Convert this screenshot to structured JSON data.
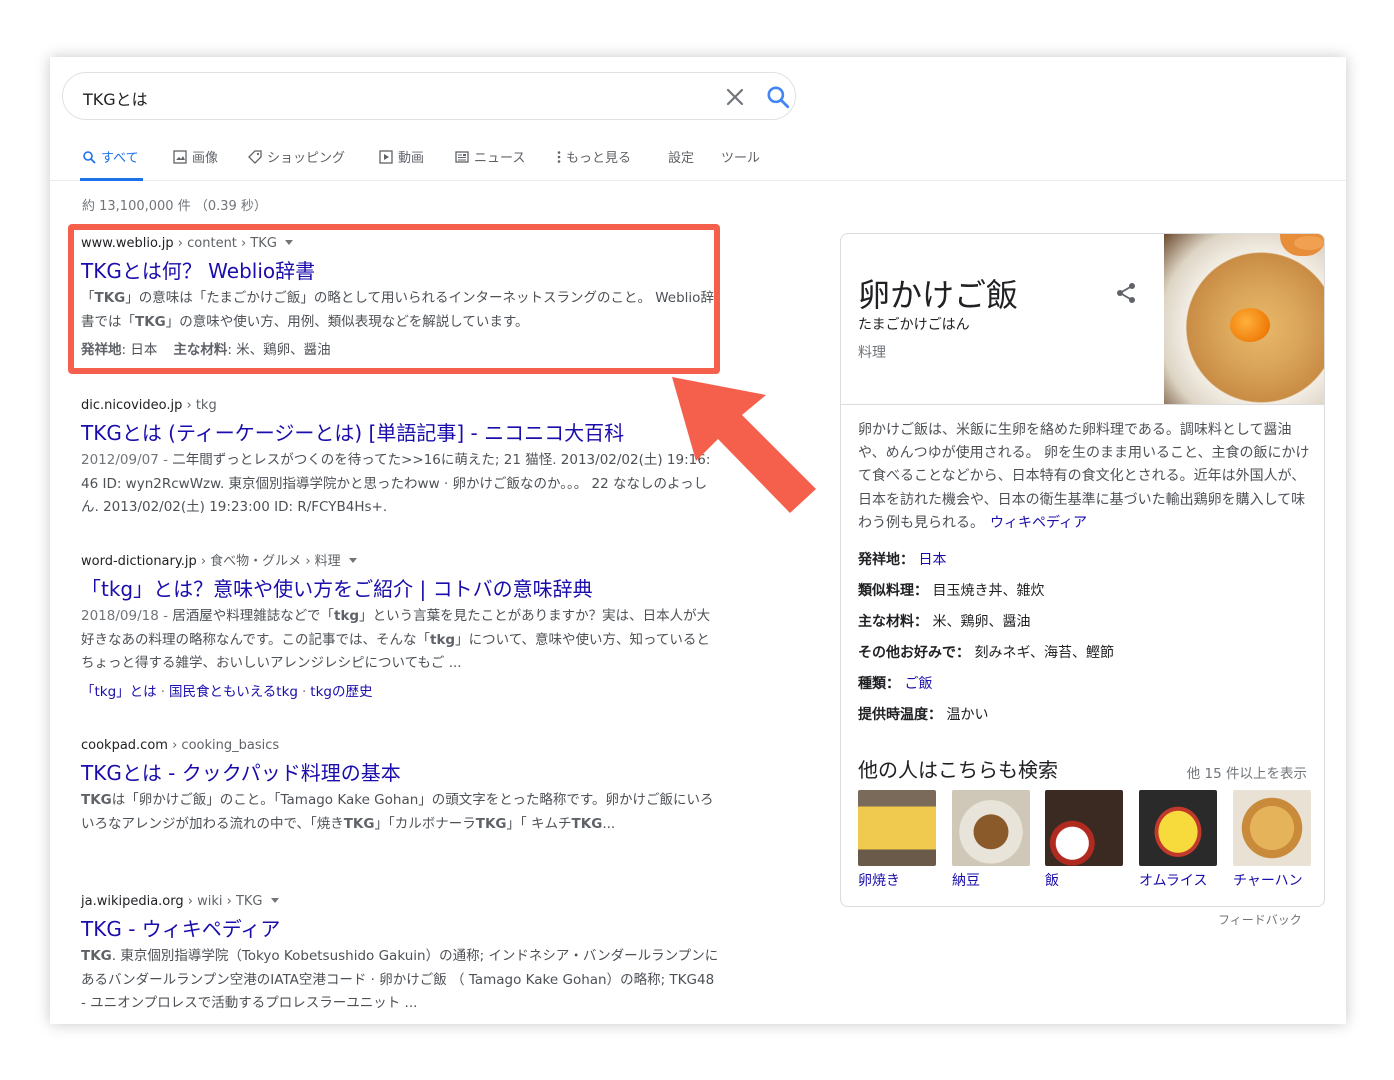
{
  "search": {
    "query": "TKGとは"
  },
  "tabs": [
    {
      "label": "すべて",
      "icon": "search-icon",
      "active": true
    },
    {
      "label": "画像",
      "icon": "image-icon"
    },
    {
      "label": "ショッピング",
      "icon": "tag-icon"
    },
    {
      "label": "動画",
      "icon": "play-icon"
    },
    {
      "label": "ニュース",
      "icon": "news-icon"
    },
    {
      "label": "もっと見る",
      "icon": "more-vert-icon"
    },
    {
      "label": "設定"
    },
    {
      "label": "ツール"
    }
  ],
  "stats": "約 13,100,000 件 （0.39 秒）",
  "results": [
    {
      "domain": "www.weblio.jp",
      "path": " › content › TKG",
      "title": "TKGとは何？ Weblio辞書",
      "snippet_parts": [
        "「",
        "TKG",
        "」の意味は「たまごかけご飯」の略として用いられるインターネットスラングのこと。 Weblio辞書では「",
        "TKG",
        "」の意味や使い方、用例、類似表現などを解説しています。"
      ],
      "meta": [
        {
          "key": "発祥地",
          "value": ": 日本"
        },
        {
          "key": "主な材料",
          "value": ": 米、鶏卵、醤油"
        }
      ]
    },
    {
      "domain": "dic.nicovideo.jp",
      "path": " › tkg",
      "title": "TKGとは (ティーケージーとは) [単語記事] - ニコニコ大百科",
      "date": "2012/09/07 - ",
      "snippet": "二年間ずっとレスがつくのを待ってた>>16に萌えた; 21 猫怪. 2013/02/02(土) 19:16: 46 ID: wyn2RcwWzw. 東京個別指導学院かと思ったわww · 卵かけご飯なのか。。。 22 ななしのよっしん. 2013/02/02(土) 19:23:00 ID: R/FCYB4Hs+."
    },
    {
      "domain": "word-dictionary.jp",
      "path": " › 食べ物・グルメ › 料理",
      "title": "「tkg」とは？意味や使い方をご紹介 | コトバの意味辞典",
      "date": "2018/09/18 - ",
      "snippet_parts": [
        "居酒屋や料理雑誌などで「",
        "tkg",
        "」という言葉を見たことがありますか？実は、日本人が大好きなあの料理の略称なんです。この記事では、そんな「",
        "tkg",
        "」について、意味や使い方、知っているとちょっと得する雑学、おいしいアレンジレシピについてもご ..."
      ],
      "sublinks": [
        "「tkg」とは",
        "国民食ともいえるtkg",
        "tkgの歴史"
      ]
    },
    {
      "domain": "cookpad.com",
      "path": " › cooking_basics",
      "title": "TKGとは - クックパッド料理の基本",
      "snippet_parts": [
        "TKG",
        "は「卵かけご飯」のこと。「Tamago Kake Gohan」の頭文字をとった略称です。卵かけご飯にいろいろなアレンジが加わる流れの中で、「焼き",
        "TKG",
        "」「カルボナーラ",
        "TKG",
        "」「 キムチ",
        "TKG",
        "..."
      ]
    },
    {
      "domain": "ja.wikipedia.org",
      "path": " › wiki › TKG",
      "title": "TKG - ウィキペディア",
      "snippet_parts": [
        "TKG",
        ". 東京個別指導学院（Tokyo Kobetsushido Gakuin）の通称; インドネシア・バンダールランプンにあるバンダールランプン空港のIATA空港コード · 卵かけご飯 （ Tamago Kake Gohan）の略称; TKG48 - ユニオンプロレスで活動するプロレスラーユニット ..."
      ]
    }
  ],
  "knowledge_panel": {
    "title": "卵かけご飯",
    "reading": "たまごかけごはん",
    "type": "料理",
    "description": "卵かけご飯は、米飯に生卵を絡めた卵料理である。調味料として醤油や、めんつゆが使用される。 卵を生のまま用いること、主食の飯にかけて食べることなどから、日本特有の食文化とされる。近年は外国人が、日本を訪れた機会や、日本の衛生基準に基づいた輸出鶏卵を購入して味わう例も見られる。",
    "source": "ウィキペディア",
    "facts": [
      {
        "key": "発祥地：",
        "value": "日本",
        "link": true
      },
      {
        "key": "類似料理：",
        "value": "目玉焼き丼、雑炊"
      },
      {
        "key": "主な材料：",
        "value": "米、鶏卵、醤油"
      },
      {
        "key": "その他お好みで：",
        "value": "刻みネギ、海苔、鰹節"
      },
      {
        "key": "種類：",
        "value": "ご飯",
        "link": true
      },
      {
        "key": "提供時温度：",
        "value": "温かい"
      }
    ],
    "also_search_title": "他の人はこちらも検索",
    "also_search_more": "他 15 件以上を表示",
    "also_search": [
      {
        "label": "卵焼き",
        "color": "#e8c34a"
      },
      {
        "label": "納豆",
        "color": "#9a6a3a"
      },
      {
        "label": "飯",
        "color": "#f2f0ea"
      },
      {
        "label": "オムライス",
        "color": "#f3d64a"
      },
      {
        "label": "チャーハン",
        "color": "#d9a34f"
      }
    ],
    "feedback": "フィードバック"
  },
  "colors": {
    "link": "#1a0dab",
    "accent": "#1a73e8",
    "highlight": "#f5604d"
  }
}
